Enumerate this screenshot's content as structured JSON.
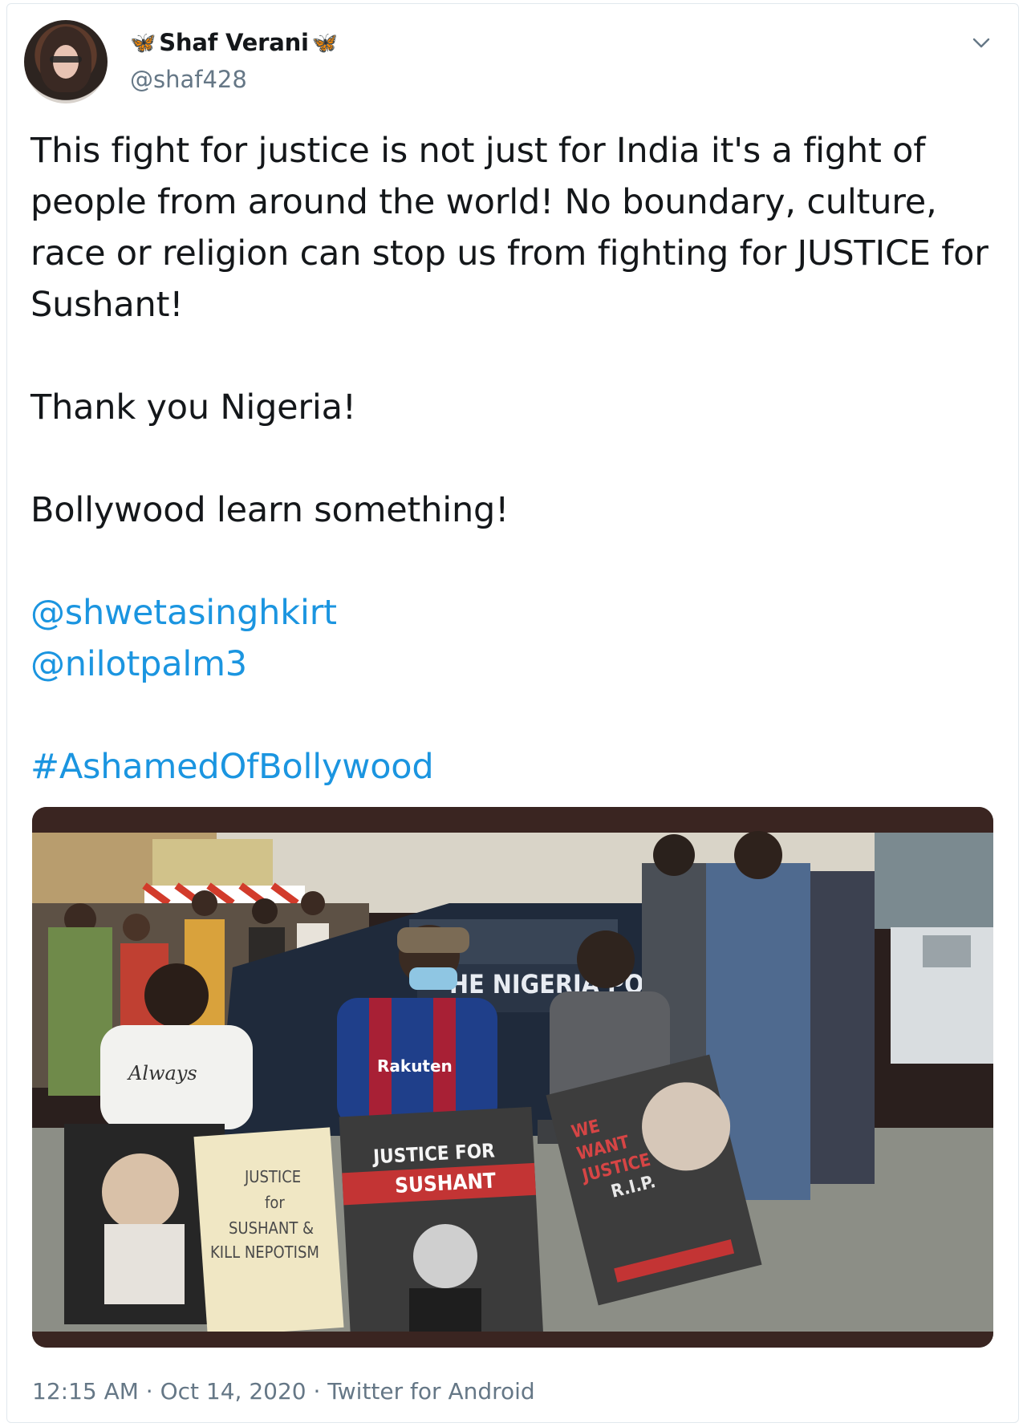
{
  "tweet": {
    "author": {
      "display_name": "Shaf Verani",
      "name_decoration": "🦋",
      "handle": "@shaf428",
      "avatar_icon": "profile-photo"
    },
    "menu_icon": "chevron-down-icon",
    "body": {
      "paragraph_1": "This fight for justice is not just for India it's a fight of people from around the world! No boundary, culture, race or religion can stop us from fighting for JUSTICE for Sushant!",
      "paragraph_2": "Thank you Nigeria!",
      "paragraph_3": "Bollywood learn something!",
      "mention_1": "@shwetasinghkirt",
      "mention_2": "@nilotpalm3",
      "hashtag": "#AshamedOfBollywood"
    },
    "media": {
      "vehicle_lettering": "HE NIGERIA PO",
      "shirt_text": "Always",
      "jersey_text": "Rakuten",
      "sign_left": [
        "JUSTICE",
        "for",
        "SUSHANT &",
        "KILL NEPOTISM"
      ],
      "sign_middle": [
        "JUSTICE FOR",
        "SUSHANT"
      ],
      "sign_right": [
        "WE",
        "WANT",
        "JUSTICE",
        "R.I.P."
      ]
    },
    "timestamp": "12:15 AM · Oct 14, 2020 · Twitter for Android"
  },
  "colors": {
    "link": "#1b95e0",
    "secondary_text": "#657786",
    "primary_text": "#14171a",
    "butterfly": "#3b73c8"
  }
}
